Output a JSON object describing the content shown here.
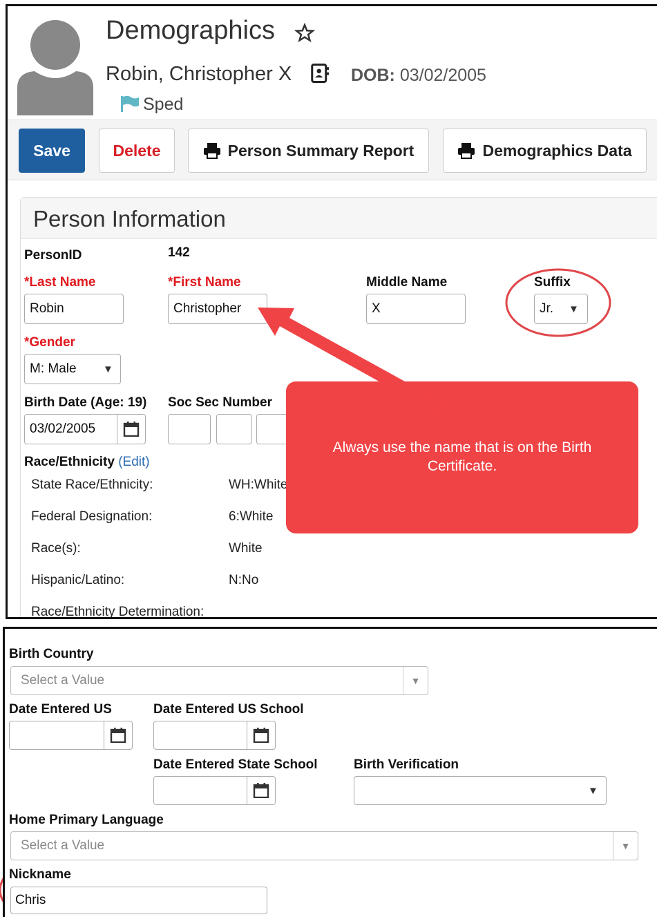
{
  "header": {
    "title": "Demographics",
    "person_name": "Robin, Christopher X",
    "dob_label": "DOB:",
    "dob_value": "03/02/2005",
    "flag_label": "Sped"
  },
  "toolbar": {
    "save_label": "Save",
    "delete_label": "Delete",
    "report_label": "Person Summary Report",
    "demo_label": "Demographics Data"
  },
  "section": {
    "title": "Person Information",
    "person_id_label": "PersonID",
    "person_id_value": "142",
    "last_name_label": "*Last Name",
    "last_name_value": "Robin",
    "first_name_label": "*First Name",
    "first_name_value": "Christopher",
    "middle_name_label": "Middle Name",
    "middle_name_value": "X",
    "suffix_label": "Suffix",
    "suffix_value": "Jr.",
    "gender_label": "*Gender",
    "gender_value": "M: Male",
    "birth_date_label": "Birth Date (Age: 19)",
    "birth_date_value": "03/02/2005",
    "ssn_label": "Soc Sec Number",
    "race_label": "Race/Ethnicity",
    "race_edit": "(Edit)",
    "race_rows": [
      {
        "label": "State Race/Ethnicity:",
        "value": "WH:White"
      },
      {
        "label": "Federal Designation:",
        "value": "6:White"
      },
      {
        "label": "Race(s):",
        "value": "White"
      },
      {
        "label": "Hispanic/Latino:",
        "value": "N:No"
      },
      {
        "label": "Race/Ethnicity Determination:",
        "value": ""
      }
    ]
  },
  "callout": {
    "text": "Always use the name that is on the Birth Certificate."
  },
  "lower": {
    "birth_country_label": "Birth Country",
    "birth_country_placeholder": "Select a Value",
    "date_entered_us_label": "Date Entered US",
    "date_entered_us_school_label": "Date Entered US School",
    "date_entered_state_school_label": "Date Entered State School",
    "birth_verification_label": "Birth Verification",
    "home_language_label": "Home Primary Language",
    "home_language_placeholder": "Select a Value",
    "nickname_label": "Nickname",
    "nickname_value": "Chris"
  },
  "colors": {
    "save_button": "#1f5fa0",
    "delete_text": "#d81f26",
    "required_label": "#e0191e",
    "callout": "#f04346",
    "annotation_circle": "#e0474b",
    "flag": "#5fb7c6"
  }
}
